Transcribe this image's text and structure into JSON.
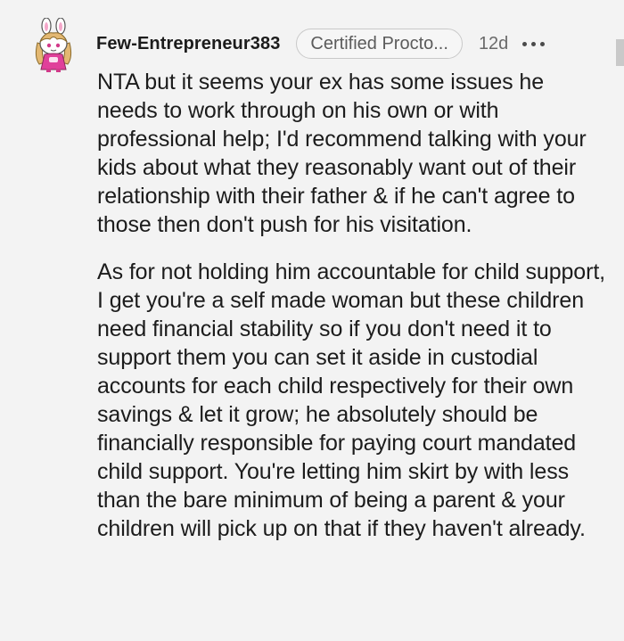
{
  "comment": {
    "username": "Few-Entrepreneur383",
    "flair": "Certified Procto...",
    "age": "12d",
    "paragraphs": [
      "NTA but it seems your ex has some issues he needs to work through on his own or with professional help; I'd recommend talking with your kids about what they reasonably want out of their relationship with their father & if he can't agree to those then don't push for his visitation.",
      "As for not holding him accountable for child support, I get you're a self made woman but these children need financial stability so if you don't need it to support them you can set it aside in custodial accounts for each child respectively for their own savings & let it grow; he absolutely should be financially responsible for paying court mandated child support. You're letting him skirt by with less than the bare minimum of being a parent & your children will pick up on that if they haven't already."
    ]
  },
  "colors": {
    "background": "#f3f3f3",
    "text": "#1c1c1c",
    "meta_text": "#6a6a6a",
    "avatar_accent": "#e0409a"
  },
  "icons": {
    "avatar": "snoo-avatar-bunny-ears",
    "more": "more-options-icon"
  }
}
